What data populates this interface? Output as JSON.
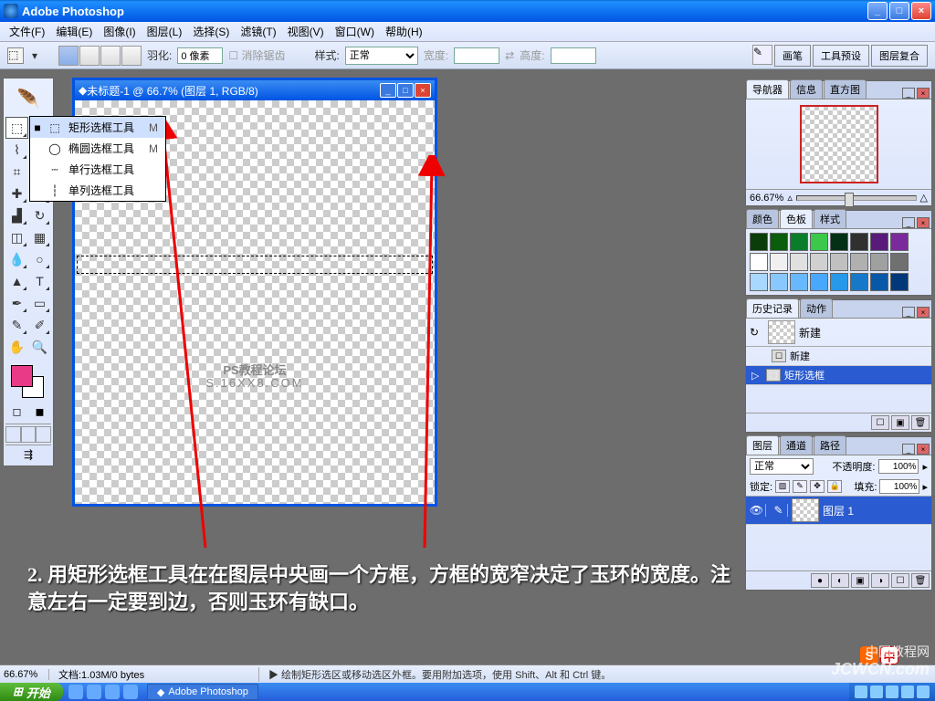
{
  "app": {
    "title": "Adobe Photoshop"
  },
  "menubar": [
    "文件(F)",
    "编辑(E)",
    "图像(I)",
    "图层(L)",
    "选择(S)",
    "滤镜(T)",
    "视图(V)",
    "窗口(W)",
    "帮助(H)"
  ],
  "options": {
    "feather_label": "羽化:",
    "feather_value": "0 像素",
    "antialias": "消除锯齿",
    "style_label": "样式:",
    "style_value": "正常",
    "width_label": "宽度:",
    "height_label": "高度:",
    "right_tabs": [
      "画笔",
      "工具预设",
      "图层复合"
    ]
  },
  "flyout": {
    "items": [
      {
        "label": "矩形选框工具",
        "key": "M",
        "bullet": "■"
      },
      {
        "label": "椭圆选框工具",
        "key": "M",
        "bullet": ""
      },
      {
        "label": "单行选框工具",
        "key": "",
        "bullet": ""
      },
      {
        "label": "单列选框工具",
        "key": "",
        "bullet": ""
      }
    ]
  },
  "document": {
    "title": "未标题-1 @ 66.7% (图层 1, RGB/8)",
    "watermark1": "PS教程论坛",
    "watermark2": "S.16XX8.COM"
  },
  "panel_titles": {
    "navigator": [
      "导航器",
      "信息",
      "直方图"
    ],
    "color": [
      "颜色",
      "色板",
      "样式"
    ],
    "history": [
      "历史记录",
      "动作"
    ],
    "layers": [
      "图层",
      "通道",
      "路径"
    ]
  },
  "navigator": {
    "zoom": "66.67%"
  },
  "swatches_colors": [
    "#0a3d0a",
    "#0a5d0a",
    "#0a7d2a",
    "#3cc84a",
    "#063015",
    "#303030",
    "#5a1a7a",
    "#7a2a9a",
    "#ffffff",
    "#f0f0f0",
    "#e0e0e0",
    "#d0d0d0",
    "#c0c0c0",
    "#b0b0b0",
    "#a0a0a0",
    "#707070",
    "#a8d8ff",
    "#88c8ff",
    "#68b8ff",
    "#48a8ff",
    "#2898e8",
    "#1878c8",
    "#0858a8",
    "#003878"
  ],
  "history": {
    "head": "新建",
    "items": [
      {
        "label": "新建",
        "selected": false
      },
      {
        "label": "矩形选框",
        "selected": true
      }
    ]
  },
  "layers": {
    "blend": "正常",
    "opacity_label": "不透明度:",
    "opacity": "100%",
    "lock_label": "锁定:",
    "fill_label": "填充:",
    "fill": "100%",
    "items": [
      {
        "name": "图层 1",
        "selected": true
      }
    ]
  },
  "tutorial_text": "2. 用矩形选框工具在在图层中央画一个方框，方框的宽窄决定了玉环的宽度。注意左右一定要到边，否则玉环有缺口。",
  "status": {
    "zoom": "66.67%",
    "doc": "文档:1.03M/0 bytes",
    "hint": "▶ 绘制矩形选区或移动选区外框。要用附加选项，使用 Shift、Alt 和 Ctrl 键。"
  },
  "taskbar": {
    "start": "开始",
    "task": "Adobe Photoshop"
  },
  "wm_bottom": "JCWCN.com",
  "wm_cn": "中国教程网"
}
